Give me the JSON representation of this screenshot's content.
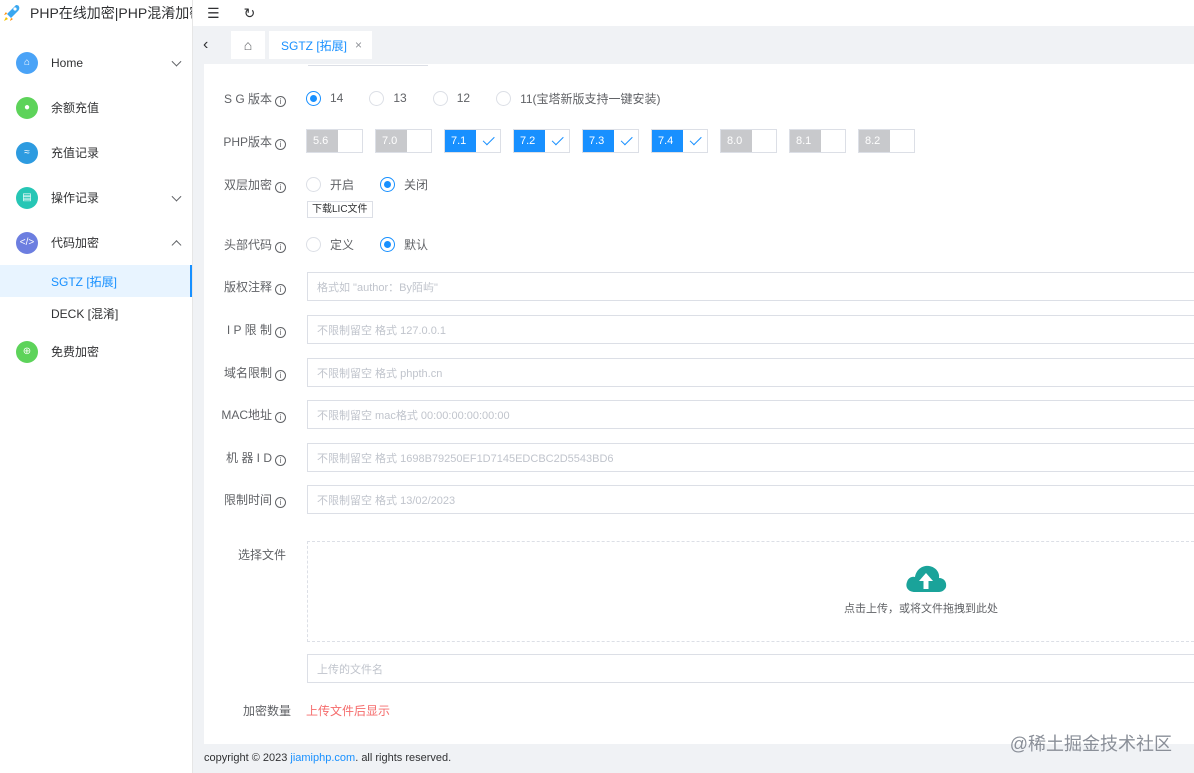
{
  "app": {
    "title": "PHP在线加密|PHP混淆加密"
  },
  "sidebar": {
    "items": [
      {
        "label": "Home",
        "icon": "home-icon",
        "color": "#4aa3f7"
      },
      {
        "label": "余额充值",
        "icon": "recharge-icon",
        "color": "#5dd35a"
      },
      {
        "label": "充值记录",
        "icon": "record-icon",
        "color": "#2d9be0"
      },
      {
        "label": "操作记录",
        "icon": "operation-icon",
        "color": "#26c6b5"
      },
      {
        "label": "代码加密",
        "icon": "code-icon",
        "color": "#6c7ee0"
      },
      {
        "label": "免费加密",
        "icon": "free-encrypt-icon",
        "color": "#5dd35a"
      }
    ],
    "submenu": [
      {
        "label": "SGTZ [拓展]",
        "active": true
      },
      {
        "label": "DECK [混淆]",
        "active": false
      }
    ]
  },
  "tabs": {
    "active_label": "SGTZ [拓展]",
    "close": "×"
  },
  "form": {
    "sg_version": {
      "label": "S G 版本",
      "options": [
        "14",
        "13",
        "12",
        "11(宝塔新版支持一键安装)"
      ],
      "selected": "14"
    },
    "php_version": {
      "label": "PHP版本",
      "options": [
        {
          "ver": "5.6",
          "checked": false
        },
        {
          "ver": "7.0",
          "checked": false
        },
        {
          "ver": "7.1",
          "checked": true
        },
        {
          "ver": "7.2",
          "checked": true
        },
        {
          "ver": "7.3",
          "checked": true
        },
        {
          "ver": "7.4",
          "checked": true
        },
        {
          "ver": "8.0",
          "checked": false
        },
        {
          "ver": "8.1",
          "checked": false
        },
        {
          "ver": "8.2",
          "checked": false
        }
      ]
    },
    "double_encrypt": {
      "label": "双层加密",
      "options": [
        "开启",
        "关闭"
      ],
      "selected": "关闭",
      "download_btn": "下载LIC文件"
    },
    "header_code": {
      "label": "头部代码",
      "options": [
        "定义",
        "默认"
      ],
      "selected": "默认"
    },
    "copyright": {
      "label": "版权注释",
      "placeholder": "格式如 \"author：By陌屿\""
    },
    "ip_limit": {
      "label": "I P 限 制",
      "placeholder": "不限制留空 格式 127.0.0.1"
    },
    "domain_limit": {
      "label": "域名限制",
      "placeholder": "不限制留空 格式 phpth.cn"
    },
    "mac_limit": {
      "label": "MAC地址",
      "placeholder": "不限制留空 mac格式 00:00:00:00:00:00"
    },
    "machine_id": {
      "label": "机 器 I D",
      "placeholder": "不限制留空 格式 1698B79250EF1D7145EDCBC2D5543BD6"
    },
    "time_limit": {
      "label": "限制时间",
      "placeholder": "不限制留空 格式 13/02/2023"
    },
    "file": {
      "label": "选择文件",
      "upload_text": "点击上传，或将文件拖拽到此处",
      "filename_placeholder": "上传的文件名"
    },
    "count": {
      "label": "加密数量",
      "value": "上传文件后显示"
    }
  },
  "footer": {
    "prefix": "copyright © 2023",
    "link": "jiamiphp.com",
    "suffix": ". all rights reserved."
  },
  "watermark": "@稀土掘金技术社区"
}
